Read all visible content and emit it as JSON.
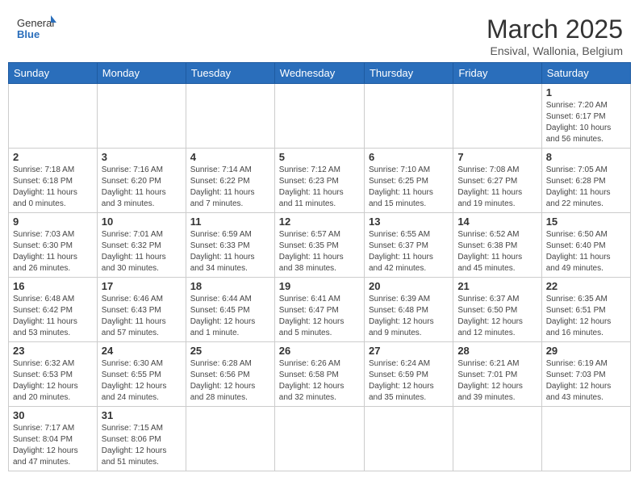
{
  "header": {
    "logo_text_normal": "General",
    "logo_text_bold": "Blue",
    "month_year": "March 2025",
    "location": "Ensival, Wallonia, Belgium"
  },
  "weekdays": [
    "Sunday",
    "Monday",
    "Tuesday",
    "Wednesday",
    "Thursday",
    "Friday",
    "Saturday"
  ],
  "weeks": [
    [
      {
        "day": "",
        "info": ""
      },
      {
        "day": "",
        "info": ""
      },
      {
        "day": "",
        "info": ""
      },
      {
        "day": "",
        "info": ""
      },
      {
        "day": "",
        "info": ""
      },
      {
        "day": "",
        "info": ""
      },
      {
        "day": "1",
        "info": "Sunrise: 7:20 AM\nSunset: 6:17 PM\nDaylight: 10 hours\nand 56 minutes."
      }
    ],
    [
      {
        "day": "2",
        "info": "Sunrise: 7:18 AM\nSunset: 6:18 PM\nDaylight: 11 hours\nand 0 minutes."
      },
      {
        "day": "3",
        "info": "Sunrise: 7:16 AM\nSunset: 6:20 PM\nDaylight: 11 hours\nand 3 minutes."
      },
      {
        "day": "4",
        "info": "Sunrise: 7:14 AM\nSunset: 6:22 PM\nDaylight: 11 hours\nand 7 minutes."
      },
      {
        "day": "5",
        "info": "Sunrise: 7:12 AM\nSunset: 6:23 PM\nDaylight: 11 hours\nand 11 minutes."
      },
      {
        "day": "6",
        "info": "Sunrise: 7:10 AM\nSunset: 6:25 PM\nDaylight: 11 hours\nand 15 minutes."
      },
      {
        "day": "7",
        "info": "Sunrise: 7:08 AM\nSunset: 6:27 PM\nDaylight: 11 hours\nand 19 minutes."
      },
      {
        "day": "8",
        "info": "Sunrise: 7:05 AM\nSunset: 6:28 PM\nDaylight: 11 hours\nand 22 minutes."
      }
    ],
    [
      {
        "day": "9",
        "info": "Sunrise: 7:03 AM\nSunset: 6:30 PM\nDaylight: 11 hours\nand 26 minutes."
      },
      {
        "day": "10",
        "info": "Sunrise: 7:01 AM\nSunset: 6:32 PM\nDaylight: 11 hours\nand 30 minutes."
      },
      {
        "day": "11",
        "info": "Sunrise: 6:59 AM\nSunset: 6:33 PM\nDaylight: 11 hours\nand 34 minutes."
      },
      {
        "day": "12",
        "info": "Sunrise: 6:57 AM\nSunset: 6:35 PM\nDaylight: 11 hours\nand 38 minutes."
      },
      {
        "day": "13",
        "info": "Sunrise: 6:55 AM\nSunset: 6:37 PM\nDaylight: 11 hours\nand 42 minutes."
      },
      {
        "day": "14",
        "info": "Sunrise: 6:52 AM\nSunset: 6:38 PM\nDaylight: 11 hours\nand 45 minutes."
      },
      {
        "day": "15",
        "info": "Sunrise: 6:50 AM\nSunset: 6:40 PM\nDaylight: 11 hours\nand 49 minutes."
      }
    ],
    [
      {
        "day": "16",
        "info": "Sunrise: 6:48 AM\nSunset: 6:42 PM\nDaylight: 11 hours\nand 53 minutes."
      },
      {
        "day": "17",
        "info": "Sunrise: 6:46 AM\nSunset: 6:43 PM\nDaylight: 11 hours\nand 57 minutes."
      },
      {
        "day": "18",
        "info": "Sunrise: 6:44 AM\nSunset: 6:45 PM\nDaylight: 12 hours\nand 1 minute."
      },
      {
        "day": "19",
        "info": "Sunrise: 6:41 AM\nSunset: 6:47 PM\nDaylight: 12 hours\nand 5 minutes."
      },
      {
        "day": "20",
        "info": "Sunrise: 6:39 AM\nSunset: 6:48 PM\nDaylight: 12 hours\nand 9 minutes."
      },
      {
        "day": "21",
        "info": "Sunrise: 6:37 AM\nSunset: 6:50 PM\nDaylight: 12 hours\nand 12 minutes."
      },
      {
        "day": "22",
        "info": "Sunrise: 6:35 AM\nSunset: 6:51 PM\nDaylight: 12 hours\nand 16 minutes."
      }
    ],
    [
      {
        "day": "23",
        "info": "Sunrise: 6:32 AM\nSunset: 6:53 PM\nDaylight: 12 hours\nand 20 minutes."
      },
      {
        "day": "24",
        "info": "Sunrise: 6:30 AM\nSunset: 6:55 PM\nDaylight: 12 hours\nand 24 minutes."
      },
      {
        "day": "25",
        "info": "Sunrise: 6:28 AM\nSunset: 6:56 PM\nDaylight: 12 hours\nand 28 minutes."
      },
      {
        "day": "26",
        "info": "Sunrise: 6:26 AM\nSunset: 6:58 PM\nDaylight: 12 hours\nand 32 minutes."
      },
      {
        "day": "27",
        "info": "Sunrise: 6:24 AM\nSunset: 6:59 PM\nDaylight: 12 hours\nand 35 minutes."
      },
      {
        "day": "28",
        "info": "Sunrise: 6:21 AM\nSunset: 7:01 PM\nDaylight: 12 hours\nand 39 minutes."
      },
      {
        "day": "29",
        "info": "Sunrise: 6:19 AM\nSunset: 7:03 PM\nDaylight: 12 hours\nand 43 minutes."
      }
    ],
    [
      {
        "day": "30",
        "info": "Sunrise: 7:17 AM\nSunset: 8:04 PM\nDaylight: 12 hours\nand 47 minutes."
      },
      {
        "day": "31",
        "info": "Sunrise: 7:15 AM\nSunset: 8:06 PM\nDaylight: 12 hours\nand 51 minutes."
      },
      {
        "day": "",
        "info": ""
      },
      {
        "day": "",
        "info": ""
      },
      {
        "day": "",
        "info": ""
      },
      {
        "day": "",
        "info": ""
      },
      {
        "day": "",
        "info": ""
      }
    ]
  ]
}
